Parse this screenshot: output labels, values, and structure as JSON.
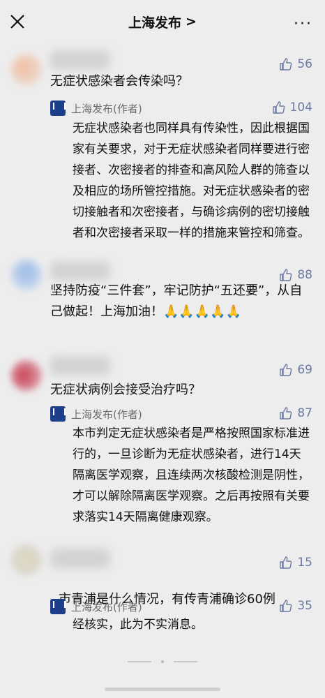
{
  "header": {
    "title": "上海发布",
    "chevron": ">",
    "more": "···"
  },
  "comments": [
    {
      "likes": "56",
      "text": "无症状感染者会传染吗？",
      "reply": {
        "author": "上海发布(作者)",
        "likes": "104",
        "text": "无症状感染者也同样具有传染性，因此根据国家有关要求，对于无症状感染者同样要进行密接者、次密接者的排查和高风险人群的筛查以及相应的场所管控措施。对无症状感染者的密切接触者和次密接者，与确诊病例的密切接触者和次密接者采取一样的措施来管控和筛查。"
      }
    },
    {
      "likes": "88",
      "text": "坚持防疫“三件套”，牢记防护“五还要”，从自己做起！上海加油！🙏🙏🙏🙏🙏"
    },
    {
      "likes": "69",
      "text": "无症状病例会接受治疗吗？",
      "reply": {
        "author": "上海发布(作者)",
        "likes": "87",
        "text": "本市判定无症状感染者是严格按照国家标准进行的，一旦诊断为无症状感染者，进行14天隔离医学观察，且连续两次核酸检测是阴性，才可以解除隔离医学观察。之后再按照有关要求落实14天隔离健康观察。"
      }
    },
    {
      "likes": "15",
      "text": "市青浦是什么情况，有传青浦确诊60例",
      "reply": {
        "author": "上海发布(作者)",
        "likes": "35",
        "text": "经核实，此为不实消息。"
      }
    }
  ]
}
